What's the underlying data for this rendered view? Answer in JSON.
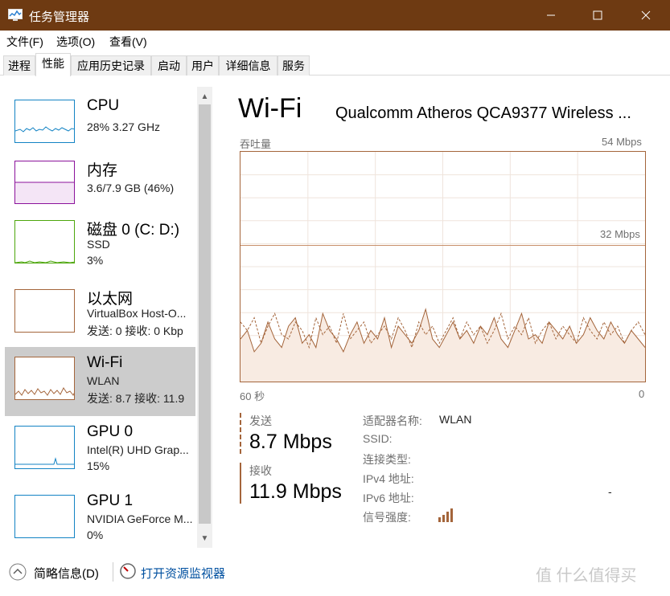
{
  "window": {
    "title": "任务管理器",
    "icon": "task-manager-icon"
  },
  "menu": [
    "文件(F)",
    "选项(O)",
    "查看(V)"
  ],
  "tabs": [
    {
      "label": "进程"
    },
    {
      "label": "性能",
      "active": true
    },
    {
      "label": "应用历史记录"
    },
    {
      "label": "启动"
    },
    {
      "label": "用户"
    },
    {
      "label": "详细信息"
    },
    {
      "label": "服务"
    }
  ],
  "sidebar": {
    "items": [
      {
        "name": "CPU",
        "line1": "28% 3.27 GHz",
        "line2": "",
        "line3": "",
        "color": "#1383c4"
      },
      {
        "name": "内存",
        "line1": "3.6/7.9 GB (46%)",
        "line2": "",
        "line3": "",
        "color": "#8b129b"
      },
      {
        "name": "磁盘 0 (C: D:)",
        "line1": "SSD",
        "line2": "3%",
        "line3": "",
        "color": "#4da60c"
      },
      {
        "name": "以太网",
        "line1": "VirtualBox Host-O...",
        "line2": "发送: 0 接收: 0 Kbp",
        "line3": "",
        "color": "#a4653b"
      },
      {
        "name": "Wi-Fi",
        "line1": "WLAN",
        "line2": "发送: 8.7 接收: 11.9",
        "line3": "",
        "color": "#a4653b",
        "active": true
      },
      {
        "name": "GPU 0",
        "line1": "Intel(R) UHD Grap...",
        "line2": "15%",
        "line3": "",
        "color": "#1383c4"
      },
      {
        "name": "GPU 1",
        "line1": "NVIDIA GeForce M...",
        "line2": "0%",
        "line3": "",
        "color": "#1383c4"
      }
    ]
  },
  "detail": {
    "title": "Wi-Fi",
    "adapter": "Qualcomm Atheros QCA9377 Wireless ...",
    "throughput_label": "吞吐量",
    "max_label": "54 Mbps",
    "mid_label": "32 Mbps",
    "time_label": "60 秒",
    "zero_label": "0",
    "send_label": "发送",
    "send_value": "8.7 Mbps",
    "recv_label": "接收",
    "recv_value": "11.9 Mbps",
    "properties": [
      {
        "key": "适配器名称:",
        "value": "WLAN"
      },
      {
        "key": "SSID:",
        "value": ""
      },
      {
        "key": "连接类型:",
        "value": ""
      },
      {
        "key": "IPv4 地址:",
        "value": ""
      },
      {
        "key": "IPv6 地址:",
        "value": "-"
      },
      {
        "key": "信号强度:",
        "value": ""
      }
    ],
    "signal_bars": 4
  },
  "bottom": {
    "brief_label": "简略信息(D)",
    "monitor_label": "打开资源监视器"
  },
  "watermark": "值 什么值得买",
  "chart_data": {
    "type": "line",
    "title": "吞吐量",
    "xlabel": "60 秒",
    "ylabel": "",
    "ylim": [
      0,
      54
    ],
    "unit": "Mbps",
    "series": [
      {
        "name": "接收",
        "style": "solid",
        "values": [
          10,
          12,
          7,
          9,
          14,
          10,
          8,
          13,
          15,
          9,
          11,
          8,
          16,
          12,
          10,
          7,
          11,
          14,
          9,
          12,
          10,
          15,
          8,
          13,
          11,
          9,
          12,
          17,
          10,
          8,
          11,
          14,
          10,
          12,
          9,
          13,
          11,
          15,
          10,
          8,
          12,
          16,
          10,
          11,
          9,
          14,
          12,
          10,
          13,
          9,
          11,
          15,
          12,
          10,
          14,
          11,
          9,
          12,
          10,
          8
        ]
      },
      {
        "name": "发送",
        "style": "dashed",
        "values": [
          14,
          12,
          15,
          9,
          13,
          16,
          11,
          10,
          14,
          12,
          8,
          15,
          11,
          13,
          9,
          16,
          10,
          12,
          14,
          9,
          11,
          13,
          10,
          15,
          12,
          8,
          14,
          11,
          13,
          9,
          12,
          15,
          10,
          14,
          11,
          13,
          9,
          12,
          16,
          10,
          13,
          11,
          15,
          9,
          12,
          14,
          10,
          13,
          11,
          9,
          15,
          12,
          10,
          14,
          11,
          13,
          9,
          12,
          14,
          11
        ]
      }
    ],
    "grid": true
  }
}
